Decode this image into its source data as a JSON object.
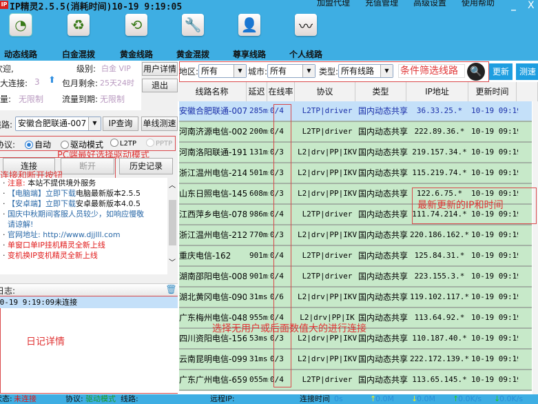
{
  "window": {
    "title": "IP精灵2.5.5(消耗时间)10-19 9:19:05",
    "logo": "IP",
    "menu": [
      "加盟代理",
      "充值管理",
      "高级设置",
      "使用帮助"
    ],
    "minimize": "_",
    "close": "X"
  },
  "toolbar": [
    {
      "label": "动态线路",
      "icon": "radar-icon"
    },
    {
      "label": "白金混拨",
      "icon": "users-refresh-icon"
    },
    {
      "label": "黄金线路",
      "icon": "user-refresh-icon"
    },
    {
      "label": "黄金混拨",
      "icon": "wrench-user-icon"
    },
    {
      "label": "尊享线路",
      "icon": "vip-user-icon"
    },
    {
      "label": "个人线路",
      "icon": "pulse-icon"
    }
  ],
  "account": {
    "welcome": "欢迎,",
    "level_label": "级别:",
    "level": "白金 VIP",
    "max_conn_label": "最大连接:",
    "max_conn": "3",
    "monthly_label": "包月剩余:",
    "monthly": "25天24时",
    "traffic_label": "流量:",
    "traffic": "无限制",
    "traffic_exp_label": "流量到期:",
    "traffic_exp": "无限制",
    "user_detail": "用户详情",
    "logout": "退出"
  },
  "line": {
    "label": "线路:",
    "value": "安徽合肥联通-007",
    "ip_query": "IP查询",
    "speed_test": "单线测速"
  },
  "protocol": {
    "label": "协议:",
    "options": [
      "自动",
      "驱动模式",
      "L2TP",
      "PPTP"
    ],
    "selected": "自动"
  },
  "actions": {
    "connect": "连接",
    "disconnect": "断开",
    "history": "历史记录"
  },
  "news": [
    {
      "parts": [
        [
          "注意:",
          "red"
        ],
        [
          "  本站不提供境外服务",
          "blk"
        ]
      ]
    },
    {
      "parts": [
        [
          "【电脑端】立即下载",
          "blue"
        ],
        [
          "电脑最新版本2.5.5",
          "blk"
        ]
      ]
    },
    {
      "parts": [
        [
          "【安卓端】立即下载",
          "blue"
        ],
        [
          "安卓最新版本4.0.5",
          "blk"
        ]
      ]
    },
    {
      "parts": [
        [
          "国庆中秋期间客服人员较少，如响应慢敬",
          "blue"
        ]
      ]
    },
    {
      "parts": [
        [
          "请谅解!",
          "blue"
        ]
      ]
    },
    {
      "parts": [
        [
          "官网地址: ",
          "blue"
        ],
        [
          "http://www.djjlll.com",
          "blue"
        ]
      ]
    },
    {
      "parts": [
        [
          "单窗口单IP挂机精灵全新上线",
          "red"
        ]
      ]
    },
    {
      "parts": [
        [
          "变机换IP变机精灵全新上线",
          "red"
        ]
      ]
    }
  ],
  "log": {
    "label": "日志:",
    "entries": [
      "10-19 9:19:09未连接"
    ]
  },
  "filter": {
    "region_label": "地区:",
    "region": "所有",
    "city_label": "城市:",
    "city": "所有",
    "type_label": "类型:",
    "type": "所有线路",
    "search_placeholder": "条件筛选线路",
    "refresh": "更新",
    "speed": "测速"
  },
  "table": {
    "columns": [
      "线路名称",
      "延迟",
      "在线率",
      "协议",
      "类型",
      "IP地址",
      "更新时间"
    ],
    "rows": [
      [
        "安徽合肥联通-007",
        "285ms",
        "0/4",
        "L2TP|driver",
        "国内动态共享",
        "36.33.25.*",
        "10-19 09:19"
      ],
      [
        "河南济源电信-002",
        "200ms",
        "0/4",
        "L2TP|driver",
        "国内动态共享",
        "222.89.36.*",
        "10-19 09:19"
      ],
      [
        "河南洛阳联通-191",
        "131ms",
        "0/3",
        "L2|drv|PP|IKV",
        "国内动态共享",
        "219.157.34.*",
        "10-19 09:19"
      ],
      [
        "浙江温州电信-214",
        "501ms",
        "0/3",
        "L2|drv|PP|IKV",
        "国内动态共享",
        "115.219.74.*",
        "10-19 09:19"
      ],
      [
        "山东日照电信-145",
        "608ms",
        "0/3",
        "L2|drv|PP|IKV",
        "国内动态共享",
        "122.6.75.*",
        "10-19 09:19"
      ],
      [
        "江西萍乡电信-078",
        "986ms",
        "0/4",
        "L2TP|driver",
        "国内动态共享",
        "111.74.214.*",
        "10-19 09:19"
      ],
      [
        "浙江温州电信-212",
        "770ms",
        "0/3",
        "L2|drv|PP|IKV",
        "国内动态共享",
        "220.186.162.*",
        "10-19 09:19"
      ],
      [
        "重庆电信-162",
        "901ms",
        "0/4",
        "L2TP|driver",
        "国内动态共享",
        "125.84.31.*",
        "10-19 09:19"
      ],
      [
        "湖南邵阳电信-008",
        "901ms",
        "0/4",
        "L2TP|driver",
        "国内动态共享",
        "223.155.3.*",
        "10-19 09:19"
      ],
      [
        "湖北黄冈电信-090",
        "31ms",
        "0/6",
        "L2|drv|PP|IKV",
        "国内动态共享",
        "119.102.117.*",
        "10-19 09:19"
      ],
      [
        "广东梅州电信-048",
        "955ms",
        "0/4",
        "L2|drv|PP|IK",
        "国内动态共享",
        "113.64.92.*",
        "10-19 09:19"
      ],
      [
        "四川资阳电信-156",
        "53ms",
        "0/3",
        "L2|drv|PP|IKV",
        "国内动态共享",
        "110.187.40.*",
        "10-19 09:19"
      ],
      [
        "云南昆明电信-099",
        "31ms",
        "0/3",
        "L2|drv|PP|IKV",
        "国内动态共享",
        "222.172.139.*",
        "10-19 09:19"
      ],
      [
        "广东广州电信-659",
        "055ms",
        "0/4",
        "L2TP|driver",
        "国内动态共享",
        "113.65.145.*",
        "10-19 09:19"
      ]
    ]
  },
  "annotations": {
    "pc_mode": "PC端最好选择驱动模式",
    "connect_buttons": "连接和断开按钮",
    "latest_ip": "最新更新的IP和时间",
    "choose": "选择无用户或后面数值大的进行连接",
    "log_detail": "日记详情"
  },
  "status": {
    "state_label": "状态:",
    "state": "未连接",
    "protocol_label": "协议:",
    "protocol": "驱动模式",
    "line_label": "线路:",
    "remote_label": "远程IP:",
    "time_label": "连接时间",
    "time": "0s",
    "up_total": "0.0M",
    "down_total": "0.0M",
    "up_speed": "0.0K/s",
    "down_speed": "0.0K/s"
  },
  "colors": {
    "accent": "#3eaee3",
    "row_bg": "#c7e9c9",
    "selected_row": "#c4e0f9",
    "annotation": "#e03434"
  }
}
